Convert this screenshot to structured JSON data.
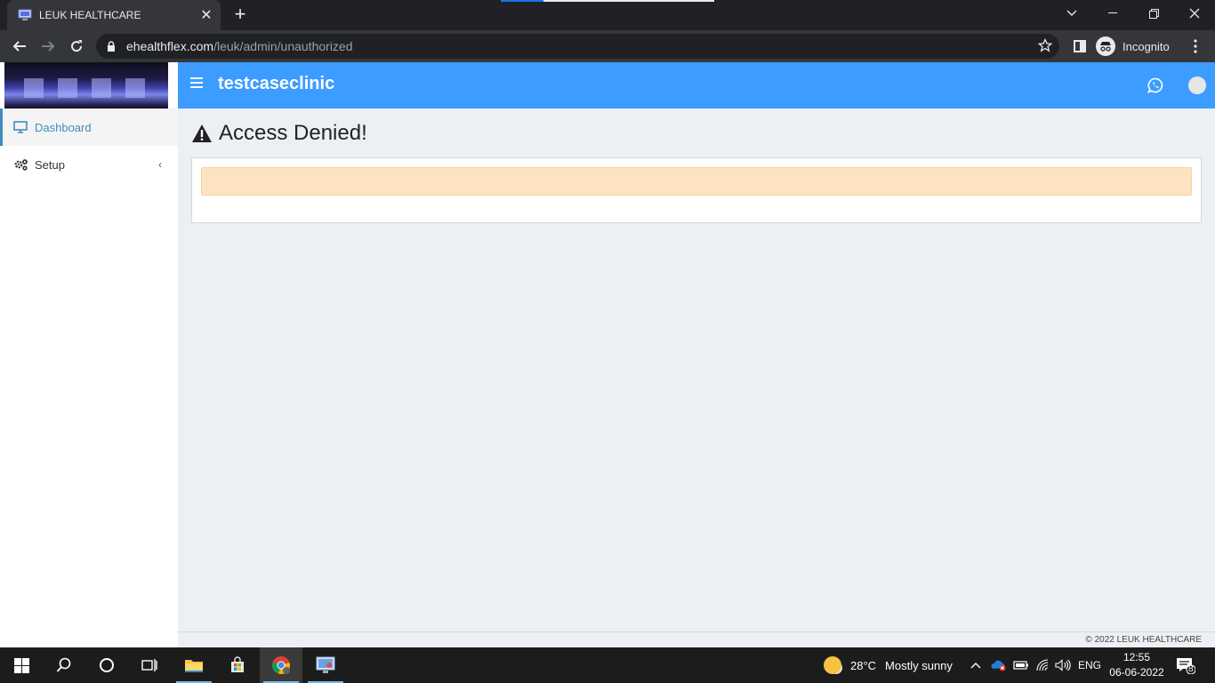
{
  "browser": {
    "tab_title": "LEUK HEALTHCARE",
    "url_domain": "ehealthflex.com",
    "url_path": "/leuk/admin/unauthorized",
    "profile_label": "Incognito"
  },
  "app": {
    "clinic_name": "testcaseclinic",
    "sidebar": {
      "items": [
        {
          "label": "Dashboard",
          "icon": "monitor-icon",
          "active": true
        },
        {
          "label": "Setup",
          "icon": "gears-icon",
          "active": false
        }
      ]
    },
    "page_title": "Access Denied!",
    "alert_text": "",
    "footer": "© 2022 LEUK HEALTHCARE",
    "colors": {
      "header": "#3c9cff",
      "accent": "#3c8dbc",
      "alert_bg": "#fde3c0"
    }
  },
  "taskbar": {
    "weather_temp": "28°C",
    "weather_text": "Mostly sunny",
    "language": "ENG",
    "time": "12:55",
    "date": "06-06-2022",
    "notification_count": "8"
  }
}
